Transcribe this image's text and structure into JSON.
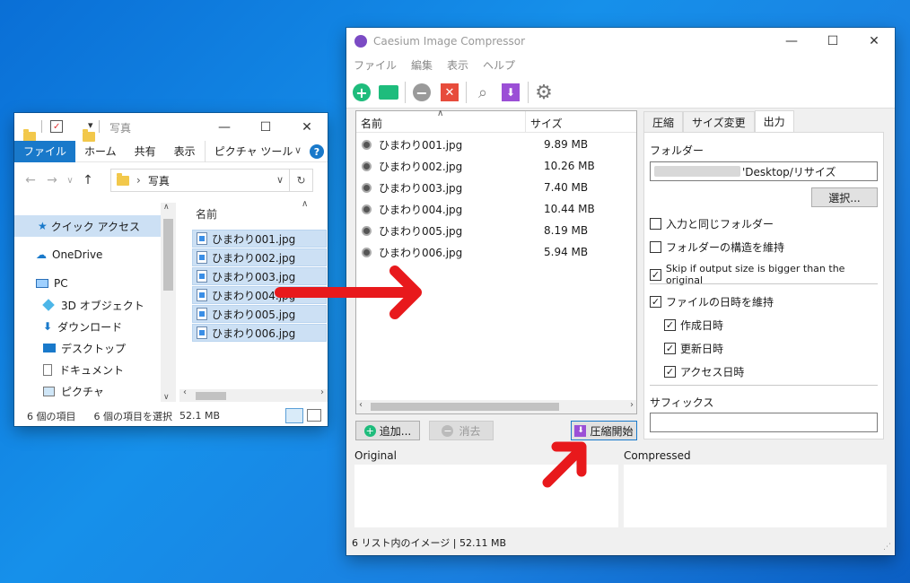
{
  "explorer": {
    "title": "写真",
    "ribbon_tabs": [
      "ファイル",
      "ホーム",
      "共有",
      "表示",
      "ピクチャ ツール"
    ],
    "address": "写真",
    "nav_items": [
      "クイック アクセス",
      "OneDrive",
      "PC",
      "3D オブジェクト",
      "ダウンロード",
      "デスクトップ",
      "ドキュメント",
      "ピクチャ"
    ],
    "column_name": "名前",
    "files": [
      "ひまわり001.jpg",
      "ひまわり002.jpg",
      "ひまわり003.jpg",
      "ひまわり004.jpg",
      "ひまわり005.jpg",
      "ひまわり006.jpg"
    ],
    "status_count": "6 個の項目",
    "status_selected": "6 個の項目を選択",
    "status_size": "52.1 MB",
    "window_controls": {
      "minimize": "—",
      "maximize": "☐",
      "close": "✕"
    }
  },
  "caesium": {
    "title": "Caesium Image Compressor",
    "menu": [
      "ファイル",
      "編集",
      "表示",
      "ヘルプ"
    ],
    "window_controls": {
      "minimize": "—",
      "maximize": "☐",
      "close": "✕"
    },
    "list_headers": {
      "name": "名前",
      "size": "サイズ"
    },
    "rows": [
      {
        "name": "ひまわり001.jpg",
        "size": "9.89 MB"
      },
      {
        "name": "ひまわり002.jpg",
        "size": "10.26 MB"
      },
      {
        "name": "ひまわり003.jpg",
        "size": "7.40 MB"
      },
      {
        "name": "ひまわり004.jpg",
        "size": "10.44 MB"
      },
      {
        "name": "ひまわり005.jpg",
        "size": "8.19 MB"
      },
      {
        "name": "ひまわり006.jpg",
        "size": "5.94 MB"
      }
    ],
    "add_button": "追加...",
    "remove_button": "消去",
    "compress_button": "圧縮開始",
    "tabs": [
      "圧縮",
      "サイズ変更",
      "出力"
    ],
    "active_tab": "出力",
    "folder_label": "フォルダー",
    "folder_path": "'Desktop/リサイズ",
    "browse_button": "選択...",
    "same_folder": "入力と同じフォルダー",
    "keep_structure": "フォルダーの構造を維持",
    "skip_bigger": "Skip if output size is bigger than the original",
    "keep_dates": "ファイルの日時を維持",
    "created": "作成日時",
    "modified": "更新日時",
    "accessed": "アクセス日時",
    "suffix_label": "サフィックス",
    "suffix_value": "",
    "original_label": "Original",
    "compressed_label": "Compressed",
    "status": "6 リスト内のイメージ | 52.11 MB",
    "checks": {
      "same_folder": false,
      "keep_structure": false,
      "skip_bigger": true,
      "keep_dates": true,
      "created": true,
      "modified": true,
      "accessed": true
    }
  },
  "colors": {
    "accent": "#1979ca",
    "arrow": "#e8191c",
    "purple": "#9b4fd6",
    "green": "#1ebc7c",
    "red": "#e74c3c"
  }
}
